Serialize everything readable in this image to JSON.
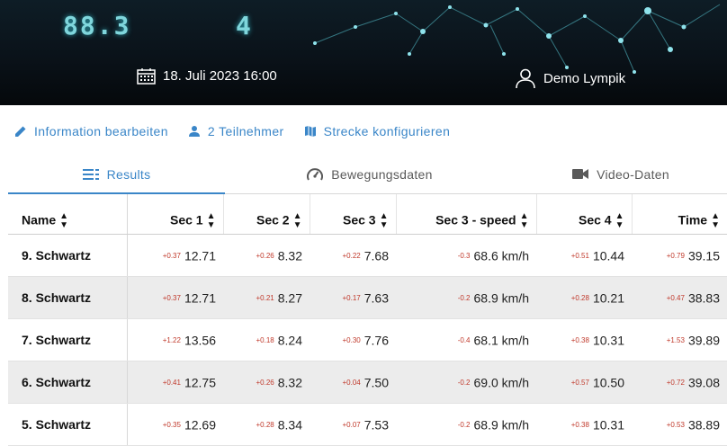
{
  "banner": {
    "digits_left": "88.3",
    "digits_right": "4",
    "date_icon": "calendar-icon",
    "date": "18. Juli 2023 16:00",
    "user_icon": "user-icon",
    "user": "Demo Lympik"
  },
  "actions": [
    {
      "icon": "pencil-icon",
      "label": "Information bearbeiten"
    },
    {
      "icon": "person-icon",
      "label": "2 Teilnehmer"
    },
    {
      "icon": "map-icon",
      "label": "Strecke konfigurieren"
    }
  ],
  "tabs": [
    {
      "icon": "list-icon",
      "label": "Results",
      "active": true
    },
    {
      "icon": "speedometer-icon",
      "label": "Bewegungsdaten",
      "active": false
    },
    {
      "icon": "video-camera-icon",
      "label": "Video-Daten",
      "active": false
    }
  ],
  "table": {
    "headers": [
      "Name",
      "Sec 1",
      "Sec 2",
      "Sec 3",
      "Sec 3 - speed",
      "Sec 4",
      "Time"
    ],
    "sort_icon": "sort-icon",
    "rows": [
      {
        "name": "9. Schwartz",
        "cells": [
          [
            "+0.37",
            "12.71"
          ],
          [
            "+0.26",
            "8.32"
          ],
          [
            "+0.22",
            "7.68"
          ],
          [
            "-0.3",
            "68.6 km/h"
          ],
          [
            "+0.51",
            "10.44"
          ],
          [
            "+0.79",
            "39.15"
          ]
        ]
      },
      {
        "name": "8. Schwartz",
        "cells": [
          [
            "+0.37",
            "12.71"
          ],
          [
            "+0.21",
            "8.27"
          ],
          [
            "+0.17",
            "7.63"
          ],
          [
            "-0.2",
            "68.9 km/h"
          ],
          [
            "+0.28",
            "10.21"
          ],
          [
            "+0.47",
            "38.83"
          ]
        ]
      },
      {
        "name": "7. Schwartz",
        "cells": [
          [
            "+1.22",
            "13.56"
          ],
          [
            "+0.18",
            "8.24"
          ],
          [
            "+0.30",
            "7.76"
          ],
          [
            "-0.4",
            "68.1 km/h"
          ],
          [
            "+0.38",
            "10.31"
          ],
          [
            "+1.53",
            "39.89"
          ]
        ]
      },
      {
        "name": "6. Schwartz",
        "cells": [
          [
            "+0.41",
            "12.75"
          ],
          [
            "+0.26",
            "8.32"
          ],
          [
            "+0.04",
            "7.50"
          ],
          [
            "-0.2",
            "69.0 km/h"
          ],
          [
            "+0.57",
            "10.50"
          ],
          [
            "+0.72",
            "39.08"
          ]
        ]
      },
      {
        "name": "5. Schwartz",
        "cells": [
          [
            "+0.35",
            "12.69"
          ],
          [
            "+0.28",
            "8.34"
          ],
          [
            "+0.07",
            "7.53"
          ],
          [
            "-0.2",
            "68.9 km/h"
          ],
          [
            "+0.38",
            "10.31"
          ],
          [
            "+0.53",
            "38.89"
          ]
        ]
      }
    ]
  },
  "colors": {
    "accent": "#3a86c8",
    "delta": "#c0392b",
    "row_alt": "#ececec"
  }
}
